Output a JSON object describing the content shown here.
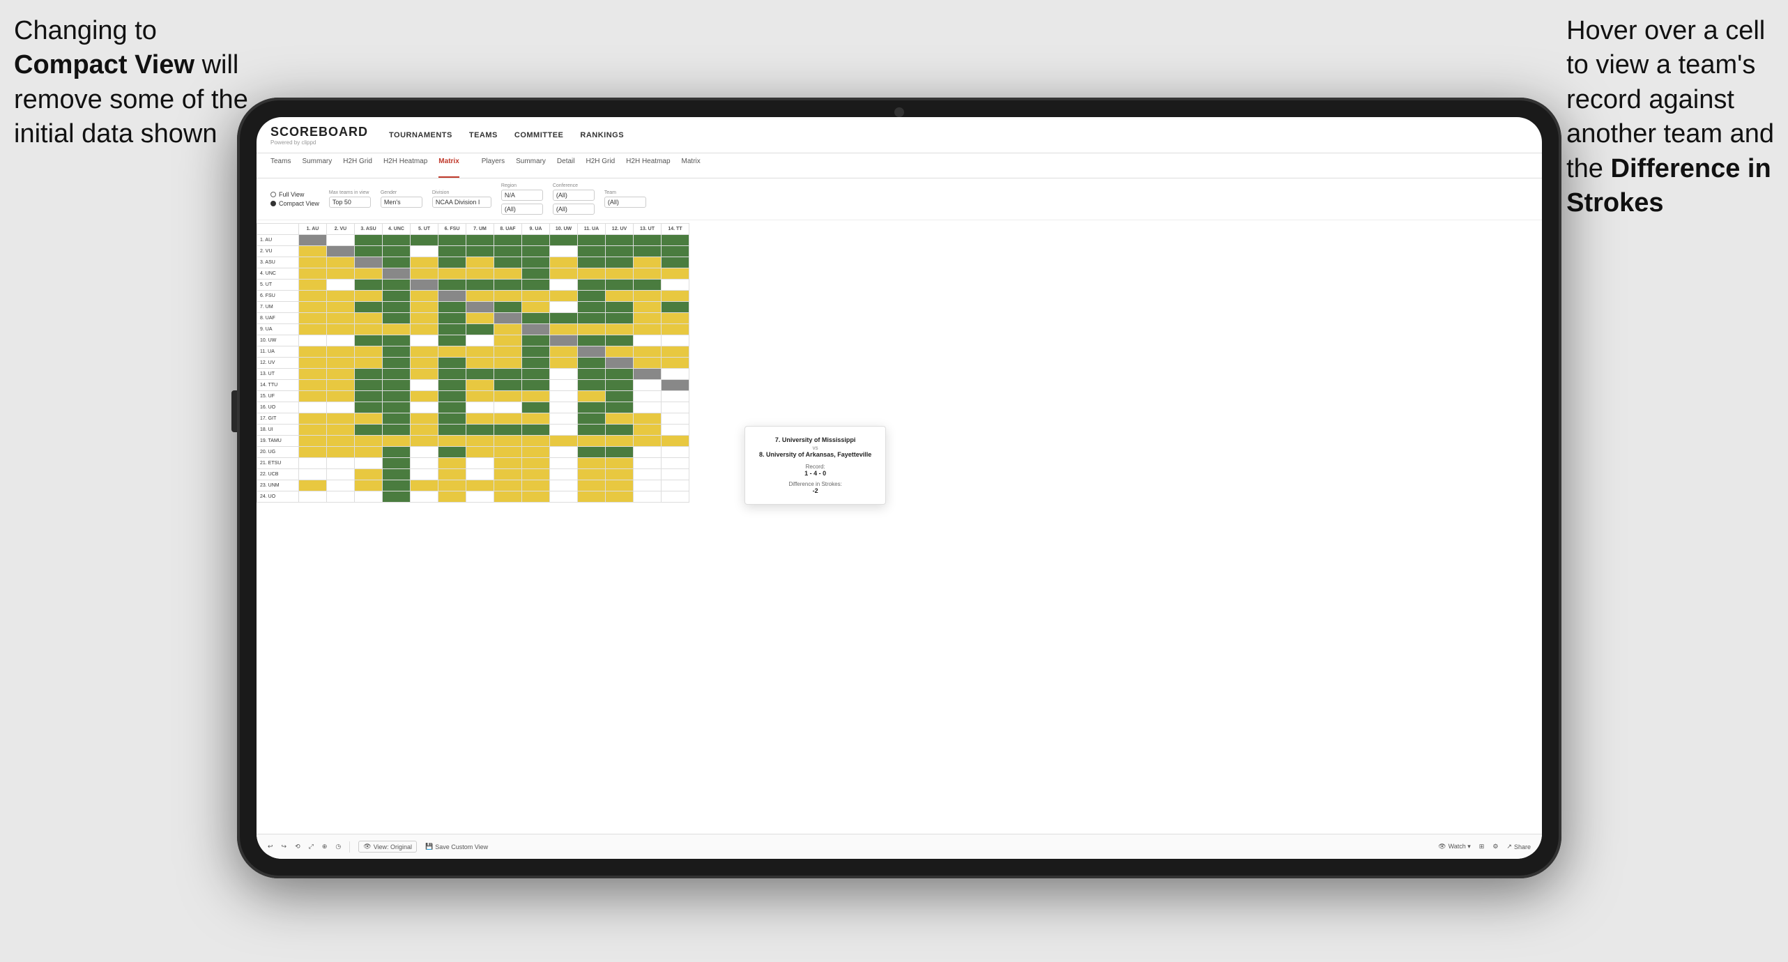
{
  "annotations": {
    "left": {
      "line1": "Changing to",
      "line2_bold": "Compact View",
      "line2_rest": " will",
      "line3": "remove some of the",
      "line4": "initial data shown"
    },
    "right": {
      "line1": "Hover over a cell",
      "line2": "to view a team's",
      "line3": "record against",
      "line4": "another team and",
      "line5_pre": "the ",
      "line5_bold": "Difference in",
      "line6_bold": "Strokes"
    }
  },
  "app": {
    "logo": "SCOREBOARD",
    "logo_sub": "Powered by clippd",
    "nav_items": [
      "TOURNAMENTS",
      "TEAMS",
      "COMMITTEE",
      "RANKINGS"
    ]
  },
  "tabs": {
    "group1": [
      "Teams",
      "Summary",
      "H2H Grid",
      "H2H Heatmap",
      "Matrix"
    ],
    "group2": [
      "Players",
      "Summary",
      "Detail",
      "H2H Grid",
      "H2H Heatmap",
      "Matrix"
    ],
    "active": "Matrix"
  },
  "filters": {
    "view_full": "Full View",
    "view_compact": "Compact View",
    "view_selected": "compact",
    "max_teams_label": "Max teams in view",
    "max_teams_value": "Top 50",
    "gender_label": "Gender",
    "gender_value": "Men's",
    "division_label": "Division",
    "division_value": "NCAA Division I",
    "region_label": "Region",
    "region_value1": "N/A",
    "region_value2": "(All)",
    "conference_label": "Conference",
    "conference_value1": "(All)",
    "conference_value2": "(All)",
    "team_label": "Team",
    "team_value": "(All)"
  },
  "column_headers": [
    "1. AU",
    "2. VU",
    "3. ASU",
    "4. UNC",
    "5. UT",
    "6. FSU",
    "7. UM",
    "8. UAF",
    "9. UA",
    "10. UW",
    "11. UA",
    "12. UV",
    "13. UT",
    "14. TT"
  ],
  "row_headers": [
    "1. AU",
    "2. VU",
    "3. ASU",
    "4. UNC",
    "5. UT",
    "6. FSU",
    "7. UM",
    "8. UAF",
    "9. UA",
    "10. UW",
    "11. UA",
    "12. UV",
    "13. UT",
    "14. TTU",
    "15. UF",
    "16. UO",
    "17. GIT",
    "18. UI",
    "19. TAMU",
    "20. UG",
    "21. ETSU",
    "22. UCB",
    "23. UNM",
    "24. UO"
  ],
  "tooltip": {
    "team1": "7. University of Mississippi",
    "vs": "vs",
    "team2": "8. University of Arkansas, Fayetteville",
    "record_label": "Record:",
    "record": "1 - 4 - 0",
    "diff_label": "Difference in Strokes:",
    "diff": "-2"
  },
  "toolbar": {
    "undo": "↩",
    "redo": "↪",
    "btn1": "⟲",
    "btn2": "⤢",
    "btn3": "⊕",
    "btn4": "◷",
    "view_original": "View: Original",
    "save_custom": "Save Custom View",
    "watch": "Watch ▾",
    "share": "Share"
  }
}
